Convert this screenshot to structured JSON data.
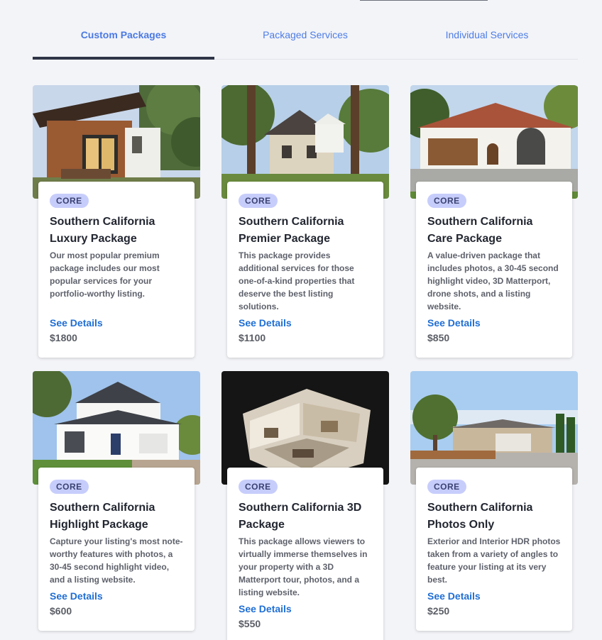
{
  "tabs": [
    {
      "label": "Custom Packages",
      "active": true
    },
    {
      "label": "Packaged Services",
      "active": false
    },
    {
      "label": "Individual Services",
      "active": false
    }
  ],
  "packages": [
    {
      "badge": "CORE",
      "title": "Southern California Luxury Package",
      "description": " Our most popular premium package includes our most popular services for your portfolio-worthy listing.",
      "details_label": "See Details",
      "price": "$1800"
    },
    {
      "badge": "CORE",
      "title": "Southern California Premier Package",
      "description": " This package provides additional services for those one-of-a-kind properties that deserve the best listing solutions.",
      "details_label": "See Details",
      "price": "$1100"
    },
    {
      "badge": "CORE",
      "title": "Southern California Care Package",
      "description": " A value-driven package that includes photos, a 30-45 second highlight video, 3D Matterport, drone shots, and a listing website.",
      "details_label": "See Details",
      "price": "$850"
    },
    {
      "badge": "CORE",
      "title": "Southern California Highlight Package",
      "description": " Capture your listing's most note-worthy features with photos, a 30-45 second highlight video, and a listing website.",
      "details_label": "See Details",
      "price": "$600"
    },
    {
      "badge": "CORE",
      "title": "Southern California 3D Package",
      "description": " This package allows viewers to virtually immerse themselves in your property with a 3D Matterport tour, photos, and a listing website.",
      "details_label": "See Details",
      "price": "$550"
    },
    {
      "badge": "CORE",
      "title": "Southern California Photos Only",
      "description": " Exterior and Interior HDR photos taken from a variety of angles to feature your listing at its very best.",
      "details_label": "See Details",
      "price": "$250"
    }
  ]
}
